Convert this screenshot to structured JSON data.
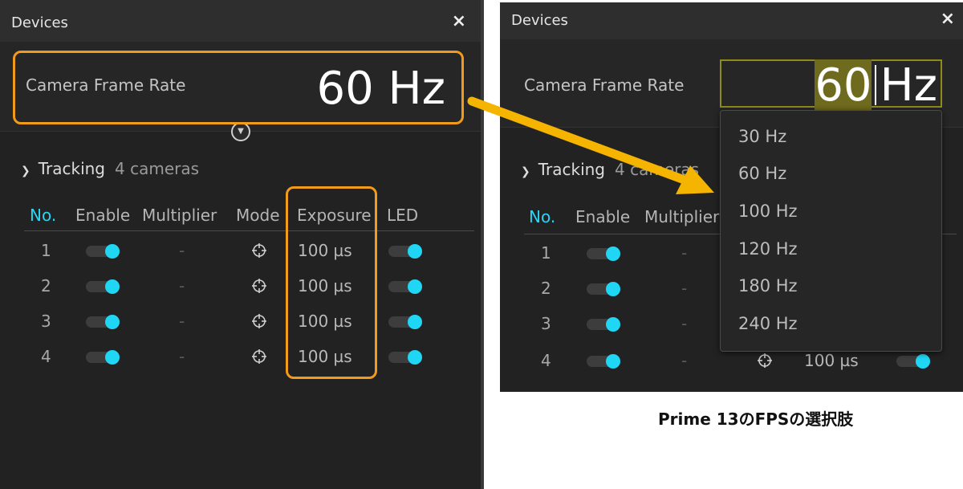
{
  "left_panel": {
    "title": "Devices",
    "close_label": "×",
    "rate_label": "Camera Frame Rate",
    "rate_value": "60 Hz",
    "group": {
      "name": "Tracking",
      "count": "4 cameras"
    },
    "columns": [
      "No.",
      "Enable",
      "Multiplier",
      "Mode",
      "Exposure",
      "LED"
    ],
    "rows": [
      {
        "no": "1",
        "multiplier": "-",
        "exposure": "100 µs"
      },
      {
        "no": "2",
        "multiplier": "-",
        "exposure": "100 µs"
      },
      {
        "no": "3",
        "multiplier": "-",
        "exposure": "100 µs"
      },
      {
        "no": "4",
        "multiplier": "-",
        "exposure": "100 µs"
      }
    ]
  },
  "right_panel": {
    "title": "Devices",
    "close_label": "×",
    "rate_label": "Camera Frame Rate",
    "rate_edit_selected": "60",
    "rate_edit_unit": "Hz",
    "group": {
      "name": "Tracking",
      "count": "4 cameras"
    },
    "columns": [
      "No.",
      "Enable",
      "Multiplier"
    ],
    "rows": [
      {
        "no": "1",
        "multiplier": "-"
      },
      {
        "no": "2",
        "multiplier": "-"
      },
      {
        "no": "3",
        "multiplier": "-"
      },
      {
        "no": "4",
        "multiplier": "-",
        "exposure": "100 µs"
      }
    ],
    "dropdown_options": [
      "30 Hz",
      "60 Hz",
      "100 Hz",
      "120 Hz",
      "180 Hz",
      "240 Hz"
    ]
  },
  "caption": "Prime 13のFPSの選択肢",
  "colors": {
    "accent_cyan": "#1fd7f5",
    "highlight_orange": "#f29a1b",
    "arrow_yellow": "#f5b400",
    "panel_bg": "#222222"
  },
  "icons": {
    "close": "close-icon",
    "expander": "chevron-down-circle-icon",
    "group_toggle": "chevron-down-icon",
    "mode": "crosshair-icon"
  }
}
